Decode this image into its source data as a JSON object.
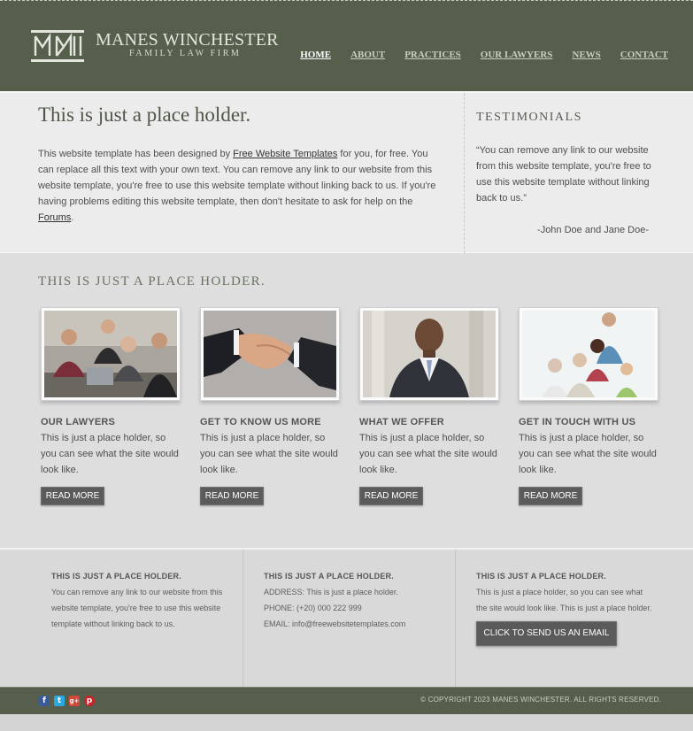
{
  "brand": {
    "title": "MANES WINCHESTER",
    "subtitle": "FAMILY LAW FIRM"
  },
  "nav": [
    {
      "label": "HOME",
      "active": true
    },
    {
      "label": "ABOUT",
      "active": false
    },
    {
      "label": "PRACTICES",
      "active": false
    },
    {
      "label": "OUR LAWYERS",
      "active": false
    },
    {
      "label": "NEWS",
      "active": false
    },
    {
      "label": "CONTACT",
      "active": false
    }
  ],
  "intro": {
    "heading": "This is just a place holder.",
    "p1": "This website template has been designed by ",
    "link1": "Free Website Templates",
    "p2": " for you, for free. You can replace all this text with your own text. You can remove any link to our website from this website template, you're free to use this website template without linking back to us. If you're having problems editing this website template, then don't hesitate to ask for help on the ",
    "link2": "Forums",
    "p3": "."
  },
  "testimonials": {
    "heading": "TESTIMONIALS",
    "quote": "“You can remove any link to our website from this website template, you're free to use this website template without linking back to us.”",
    "author": "-John Doe and Jane Doe-"
  },
  "features": {
    "heading": "THIS IS JUST A PLACE HOLDER.",
    "cards": [
      {
        "title": "OUR LAWYERS",
        "text": "This is just a place holder, so you can see what the site would look like.",
        "button": "READ MORE"
      },
      {
        "title": "GET TO KNOW US MORE",
        "text": "This is just a place holder, so you can see what the site would look like.",
        "button": "READ MORE"
      },
      {
        "title": "WHAT WE OFFER",
        "text": "This is just a place holder, so you can see what the site would look like.",
        "button": "READ MORE"
      },
      {
        "title": "GET IN TOUCH WITH US",
        "text": "This is just a place holder, so you can see what the site would look like.",
        "button": "READ MORE"
      }
    ]
  },
  "info": {
    "col1": {
      "heading": "THIS IS JUST A PLACE HOLDER.",
      "text": "You can remove any link to our website from this website template, you're free to use this website template without linking back to us."
    },
    "col2": {
      "heading": "THIS IS JUST A PLACE HOLDER.",
      "address": "ADDRESS: This is just a place holder.",
      "phone": "PHONE: (+20) 000 222 999",
      "email": "EMAIL: info@freewebsitetemplates.com"
    },
    "col3": {
      "heading": "THIS IS JUST A PLACE HOLDER.",
      "text": "This is just a place holder, so you can see what the site would look like. This is just a place holder.",
      "button": "CLICK TO SEND US AN EMAIL"
    }
  },
  "footer": {
    "social": [
      {
        "icon": "facebook-icon",
        "glyph": "f",
        "color": "#3b5998"
      },
      {
        "icon": "twitter-icon",
        "glyph": "t",
        "color": "#2aa9e0"
      },
      {
        "icon": "google-plus-icon",
        "glyph": "g+",
        "color": "#d34836"
      },
      {
        "icon": "pinterest-icon",
        "glyph": "p",
        "color": "#cb2027"
      }
    ],
    "copyright": "© COPYRIGHT 2023 MANES WINCHESTER. ALL RIGHTS RESERVED."
  },
  "colors": {
    "header_bg": "#555f4b",
    "accent_text": "#c9cec1",
    "button_bg": "#5b5b5b"
  }
}
